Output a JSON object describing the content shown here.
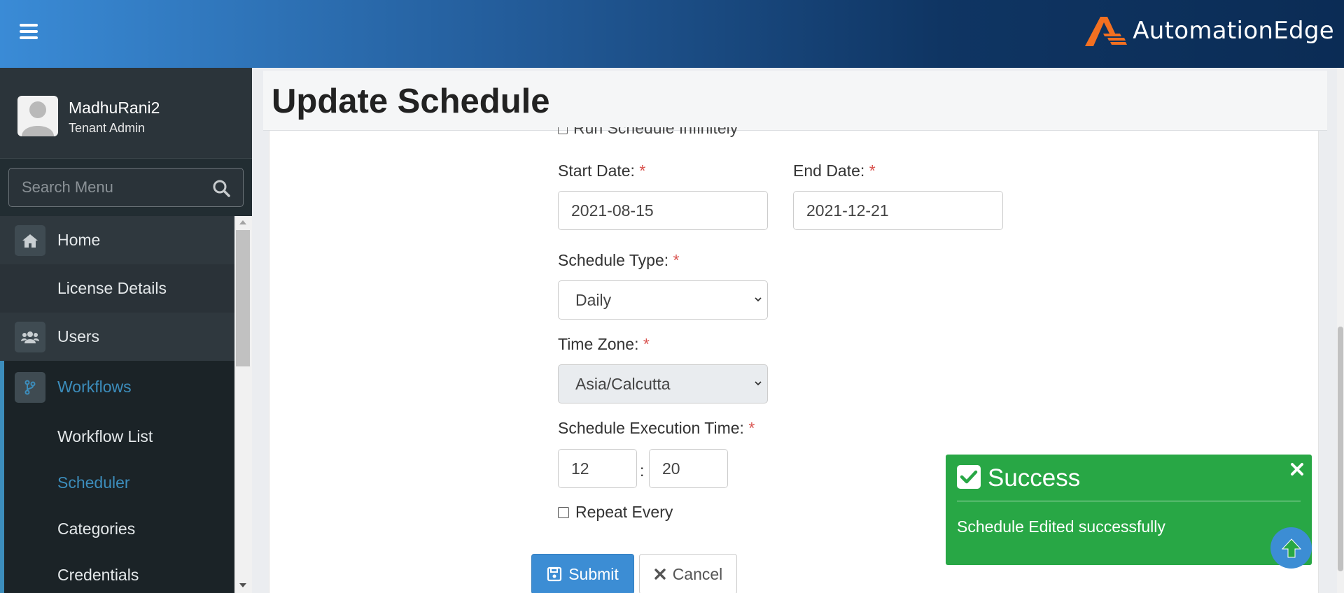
{
  "topbar": {
    "brand": "AutomationEdge"
  },
  "user": {
    "name": "MadhuRani2",
    "role": "Tenant Admin"
  },
  "search": {
    "placeholder": "Search Menu"
  },
  "menu": {
    "home": "Home",
    "license": "License Details",
    "users": "Users",
    "workflows": "Workflows",
    "workflow_list": "Workflow List",
    "scheduler": "Scheduler",
    "categories": "Categories",
    "credentials": "Credentials"
  },
  "page": {
    "title": "Update Schedule"
  },
  "form": {
    "run_infinitely": "Run Schedule Infinitely",
    "start_date_label": "Start Date:",
    "start_date": "2021-08-15",
    "end_date_label": "End Date:",
    "end_date": "2021-12-21",
    "schedule_type_label": "Schedule Type:",
    "schedule_type": "Daily",
    "time_zone_label": "Time Zone:",
    "time_zone": "Asia/Calcutta",
    "exec_time_label": "Schedule Execution Time:",
    "hour": "12",
    "colon": ":",
    "minute": "20",
    "repeat_every": "Repeat Every",
    "required_mark": "*",
    "submit": "Submit",
    "cancel": "Cancel"
  },
  "toast": {
    "title": "Success",
    "message": "Schedule Edited successfully"
  },
  "colors": {
    "accent": "#3c8dbc",
    "success": "#28a745",
    "sidebar": "#222d32",
    "required": "#d9534f"
  }
}
